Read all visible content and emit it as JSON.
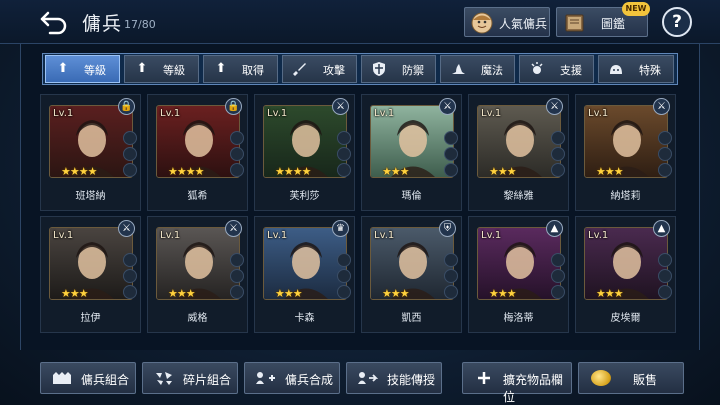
{
  "header": {
    "title": "傭兵",
    "count": "17/80",
    "popular_label": "人氣傭兵",
    "codex_label": "圖鑑",
    "new_badge": "NEW",
    "help_label": "?"
  },
  "filters": [
    {
      "label": "等級",
      "icon": "arrow-up-icon",
      "active": true
    },
    {
      "label": "等級",
      "icon": "arrow-up-icon",
      "active": false
    },
    {
      "label": "取得",
      "icon": "arrow-up-icon",
      "active": false
    },
    {
      "label": "攻擊",
      "icon": "sword-icon",
      "active": false
    },
    {
      "label": "防禦",
      "icon": "shield-icon",
      "active": false
    },
    {
      "label": "魔法",
      "icon": "witch-hat-icon",
      "active": false
    },
    {
      "label": "支援",
      "icon": "support-icon",
      "active": false
    },
    {
      "label": "特殊",
      "icon": "slime-icon",
      "active": false
    }
  ],
  "mercenaries": [
    {
      "name": "班塔納",
      "level": "Lv.1",
      "stars": "★★★★",
      "badge": "lock-icon",
      "colors": [
        "#5a1f1f",
        "#2a1512"
      ]
    },
    {
      "name": "狐希",
      "level": "Lv.1",
      "stars": "★★★★",
      "badge": "lock-icon",
      "colors": [
        "#6b2020",
        "#2b1010"
      ]
    },
    {
      "name": "芙利莎",
      "level": "Lv.1",
      "stars": "★★★★",
      "badge": "sword-icon",
      "colors": [
        "#2d4a2c",
        "#17261a"
      ]
    },
    {
      "name": "瑪倫",
      "level": "Lv.1",
      "stars": "★★★",
      "badge": "sword-icon",
      "colors": [
        "#8fb39e",
        "#3c5b4b"
      ]
    },
    {
      "name": "黎絲雅",
      "level": "Lv.1",
      "stars": "★★★",
      "badge": "sword-icon",
      "colors": [
        "#5e5a50",
        "#2b2a26"
      ]
    },
    {
      "name": "納塔莉",
      "level": "Lv.1",
      "stars": "★★★",
      "badge": "sword-icon",
      "colors": [
        "#6b4a2c",
        "#2d1d12"
      ]
    },
    {
      "name": "拉伊",
      "level": "Lv.1",
      "stars": "★★★",
      "badge": "sword-icon",
      "colors": [
        "#4a4440",
        "#1c1a18"
      ]
    },
    {
      "name": "威格",
      "level": "Lv.1",
      "stars": "★★★",
      "badge": "sword-icon",
      "colors": [
        "#5a5654",
        "#242221"
      ]
    },
    {
      "name": "卡森",
      "level": "Lv.1",
      "stars": "★★★",
      "badge": "crown-icon",
      "colors": [
        "#3d5d86",
        "#1b2a3f"
      ]
    },
    {
      "name": "凱西",
      "level": "Lv.1",
      "stars": "★★★",
      "badge": "shield-icon",
      "colors": [
        "#4b5a6a",
        "#1e2630"
      ]
    },
    {
      "name": "梅洛蒂",
      "level": "Lv.1",
      "stars": "★★★",
      "badge": "witch-hat-icon",
      "colors": [
        "#5a2a5e",
        "#241128"
      ]
    },
    {
      "name": "皮埃爾",
      "level": "Lv.1",
      "stars": "★★★",
      "badge": "witch-hat-icon",
      "colors": [
        "#4a2a4f",
        "#1e1220"
      ]
    }
  ],
  "bottom": {
    "combine_label": "傭兵組合",
    "fragment_label": "碎片組合",
    "merge_label": "傭兵合成",
    "skill_label": "技能傳授",
    "expand_label": "擴充物品欄位",
    "sell_label": "販售"
  }
}
